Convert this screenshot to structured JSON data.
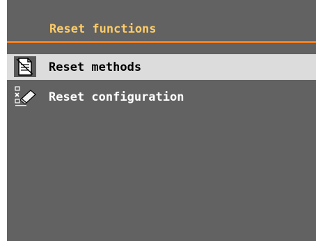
{
  "header": {
    "title": "Reset functions"
  },
  "menu": {
    "items": [
      {
        "label": "Reset methods",
        "icon": "document-erase-icon",
        "selected": true
      },
      {
        "label": "Reset configuration",
        "icon": "eraser-icon",
        "selected": false
      }
    ]
  },
  "colors": {
    "background": "#626262",
    "title_text": "#ffcc66",
    "accent_rule": "#ff7f1e",
    "selected_row": "#dcdcdc"
  }
}
